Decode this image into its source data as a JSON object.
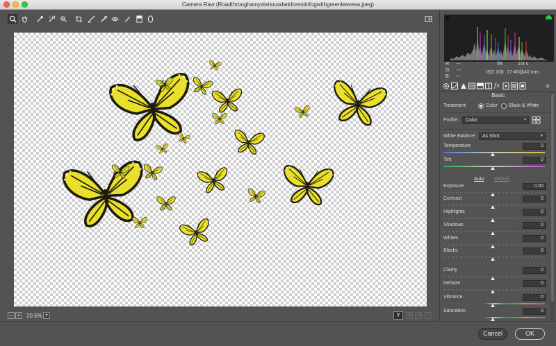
{
  "window": {
    "title": "Camera Raw (Roadthroughamysteriousdarkforestinfogwithgreenleavesa.jpeg)"
  },
  "toolbar": {
    "tools": [
      "zoom-tool",
      "hand-tool",
      "white-balance-tool",
      "color-sampler-tool",
      "targeted-adjustment-tool",
      "crop-tool",
      "straighten-tool",
      "spot-removal-tool",
      "red-eye-tool",
      "adjustment-brush-tool",
      "graduated-filter-tool",
      "radial-filter-tool"
    ]
  },
  "statusbar": {
    "zoom": "20.5%",
    "view_mode": "Y"
  },
  "footer": {
    "cancel": "Cancel",
    "ok": "OK"
  },
  "histogram": {
    "r_label": "R:",
    "r_value": "---",
    "g_label": "G:",
    "g_value": "---",
    "b_label": "B:",
    "b_value": "---",
    "aperture": "f/8",
    "shutter": "1/4 s",
    "iso": "ISO 100",
    "lens": "17-40@40 mm"
  },
  "panel": {
    "section": "Basic",
    "treatment_label": "Treatment:",
    "treatment_color": "Color",
    "treatment_bw": "Black & White",
    "profile_label": "Profile:",
    "profile_value": "Color",
    "wb_label": "White Balance:",
    "wb_value": "As Shot",
    "auto": "Auto",
    "default": "Default",
    "sliders": [
      {
        "label": "Temperature",
        "value": "0"
      },
      {
        "label": "Tint",
        "value": "0"
      },
      {
        "label": "Exposure",
        "value": "0.00"
      },
      {
        "label": "Contrast",
        "value": "0"
      },
      {
        "label": "Highlights",
        "value": "0"
      },
      {
        "label": "Shadows",
        "value": "0"
      },
      {
        "label": "Whites",
        "value": "0"
      },
      {
        "label": "Blacks",
        "value": "0"
      },
      {
        "label": "Clarity",
        "value": "0"
      },
      {
        "label": "Dehaze",
        "value": "0"
      },
      {
        "label": "Vibrance",
        "value": "0"
      },
      {
        "label": "Saturation",
        "value": "0"
      }
    ]
  },
  "colors": {
    "panel_bg": "#535353",
    "butterfly_yellow": "#e8e02a",
    "butterfly_dark": "#1e1a10",
    "ok_border": "#cfcfcf"
  }
}
